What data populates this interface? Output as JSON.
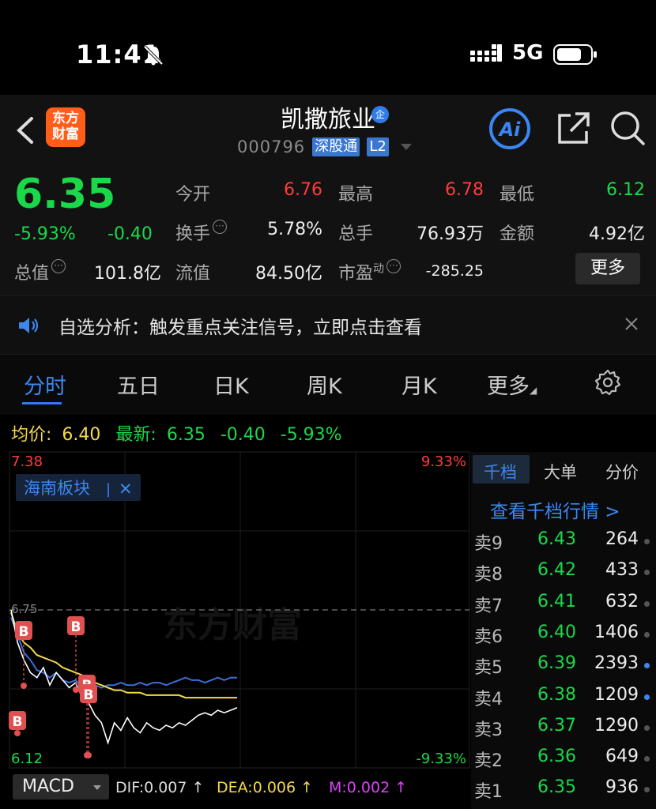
{
  "status": {
    "time": "11:41",
    "network": "5G"
  },
  "header": {
    "logo_line1": "东方",
    "logo_line2": "财富",
    "name": "凯撒旅业",
    "corp_badge": "企",
    "code": "000796",
    "tag_exchange": "深股通",
    "tag_level": "L2",
    "ai_label": "Ai"
  },
  "quote": {
    "price": "6.35",
    "change_pct": "-5.93%",
    "change": "-0.40",
    "open_label": "今开",
    "open": "6.76",
    "high_label": "最高",
    "high": "6.78",
    "low_label": "最低",
    "low": "6.12",
    "turnover_label": "换手",
    "turnover": "5.78%",
    "volume_label": "总手",
    "volume": "76.93万",
    "amount_label": "金额",
    "amount": "4.92亿",
    "mktcap_label": "总值",
    "mktcap": "101.8亿",
    "float_label": "流值",
    "float": "84.50亿",
    "pe_label": "市盈",
    "pe_sup": "动",
    "pe": "-285.25",
    "more": "更多"
  },
  "notice": {
    "text": "自选分析：触发重点关注信号，立即点击查看"
  },
  "tabs": [
    "分时",
    "五日",
    "日K",
    "周K",
    "月K",
    "更多"
  ],
  "avg": {
    "avg_label": "均价:",
    "avg_value": "6.40",
    "last_label": "最新:",
    "last_value": "6.35",
    "chg": "-0.40",
    "chg_pct": "-5.93%"
  },
  "chart_data": {
    "type": "line",
    "y_top": "7.38",
    "y_bottom": "6.12",
    "pct_top": "9.33%",
    "pct_bottom": "-9.33%",
    "prev_close": "6.75",
    "ylim": [
      6.12,
      7.38
    ],
    "sector_tag": "海南板块",
    "watermark": "东方财富",
    "series": [
      {
        "values": [
          6.75,
          6.62,
          6.55,
          6.5,
          6.48,
          6.52,
          6.45,
          6.5,
          6.47,
          6.44,
          6.46,
          6.4,
          6.38,
          6.33,
          6.3,
          6.22,
          6.3,
          6.27,
          6.32,
          6.28,
          6.26,
          6.3,
          6.28,
          6.27,
          6.29,
          6.28,
          6.3,
          6.29,
          6.31,
          6.33,
          6.34,
          6.33,
          6.35,
          6.34,
          6.35,
          6.36
        ]
      },
      {
        "values": [
          6.74,
          6.66,
          6.62,
          6.6,
          6.57,
          6.56,
          6.55,
          6.54,
          6.52,
          6.51,
          6.5,
          6.49,
          6.47,
          6.46,
          6.45,
          6.44,
          6.43,
          6.43,
          6.42,
          6.42,
          6.42,
          6.41,
          6.41,
          6.41,
          6.41,
          6.41,
          6.41,
          6.4,
          6.4,
          6.4,
          6.4,
          6.4,
          6.4,
          6.4,
          6.4,
          6.4
        ]
      },
      {
        "values": [
          6.72,
          6.65,
          6.58,
          6.55,
          6.51,
          6.5,
          6.48,
          6.5,
          6.47,
          6.46,
          6.47,
          6.44,
          6.44,
          6.45,
          6.44,
          6.45,
          6.45,
          6.46,
          6.45,
          6.45,
          6.46,
          6.45,
          6.46,
          6.46,
          6.45,
          6.46,
          6.47,
          6.48,
          6.47,
          6.47,
          6.46,
          6.47,
          6.48,
          6.47,
          6.48,
          6.48
        ]
      }
    ],
    "markers": [
      "B",
      "B",
      "B",
      "B",
      "B"
    ]
  },
  "orderbook": {
    "tabs": [
      "千档",
      "大单",
      "分价"
    ],
    "link": "查看千档行情 >",
    "rows": [
      {
        "label": "卖9",
        "price": "6.43",
        "vol": "264"
      },
      {
        "label": "卖8",
        "price": "6.42",
        "vol": "433"
      },
      {
        "label": "卖7",
        "price": "6.41",
        "vol": "632"
      },
      {
        "label": "卖6",
        "price": "6.40",
        "vol": "1406"
      },
      {
        "label": "卖5",
        "price": "6.39",
        "vol": "2393"
      },
      {
        "label": "卖4",
        "price": "6.38",
        "vol": "1209"
      },
      {
        "label": "卖3",
        "price": "6.37",
        "vol": "1290"
      },
      {
        "label": "卖2",
        "price": "6.36",
        "vol": "649"
      },
      {
        "label": "卖1",
        "price": "6.35",
        "vol": "936"
      }
    ]
  },
  "macd": {
    "label": "MACD",
    "dif": "DIF:0.007 ↑",
    "dea": "DEA:0.006 ↑",
    "m": "M:0.002 ↑"
  },
  "colors": {
    "up": "#ff3b3b",
    "down": "#19d94a",
    "accent": "#2e7cf6",
    "avg": "#f5d94a"
  },
  "icons": [
    "bell-off-icon",
    "signal-icon",
    "battery-icon",
    "back-icon",
    "share-icon",
    "search-icon",
    "speaker-icon",
    "close-icon",
    "gear-icon"
  ]
}
